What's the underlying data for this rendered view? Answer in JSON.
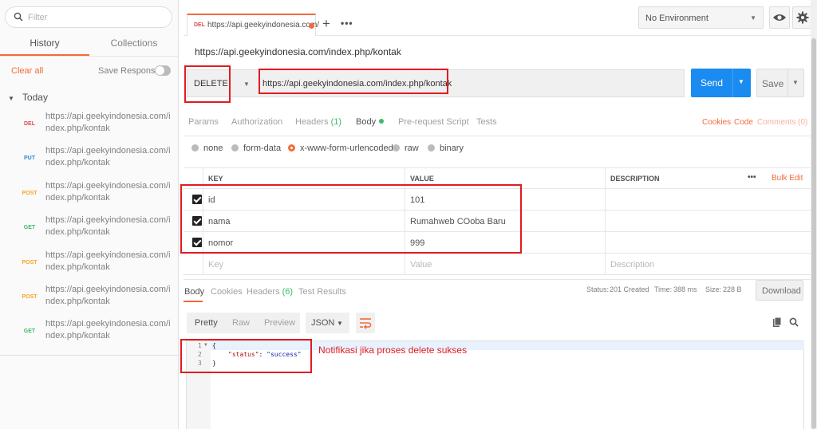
{
  "sidebar": {
    "filter_placeholder": "Filter",
    "tabs": [
      {
        "label": "History"
      },
      {
        "label": "Collections"
      }
    ],
    "clear_all": "Clear all",
    "save_responses": "Save Responses",
    "group_label": "Today",
    "items": [
      {
        "method": "DEL",
        "url": "https://api.geekyindonesia.com/index.php/kontak"
      },
      {
        "method": "PUT",
        "url": "https://api.geekyindonesia.com/index.php/kontak"
      },
      {
        "method": "POST",
        "url": "https://api.geekyindonesia.com/index.php/kontak"
      },
      {
        "method": "GET",
        "url": "https://api.geekyindonesia.com/index.php/kontak"
      },
      {
        "method": "POST",
        "url": "https://api.geekyindonesia.com/index.php/kontak"
      },
      {
        "method": "POST",
        "url": "https://api.geekyindonesia.com/index.php/kontak"
      },
      {
        "method": "GET",
        "url": "https://api.geekyindonesia.com/index.php/kontak"
      }
    ]
  },
  "tab": {
    "method": "DEL",
    "title": "https://api.geekyindonesia.com/"
  },
  "environment": "No Environment",
  "request": {
    "title": "https://api.geekyindonesia.com/index.php/kontak",
    "method": "DELETE",
    "url": "https://api.geekyindonesia.com/index.php/kontak",
    "send": "Send",
    "save": "Save"
  },
  "req_tabs": {
    "params": "Params",
    "authorization": "Authorization",
    "headers": "Headers",
    "headers_count": "(1)",
    "body": "Body",
    "prerequest": "Pre-request Script",
    "tests": "Tests",
    "cookies": "Cookies",
    "code": "Code",
    "comments": "Comments (0)"
  },
  "body_types": {
    "none": "none",
    "form_data": "form-data",
    "urlencoded": "x-www-form-urlencoded",
    "raw": "raw",
    "binary": "binary",
    "selected": "x-www-form-urlencoded"
  },
  "params_table": {
    "headers": {
      "key": "KEY",
      "value": "VALUE",
      "description": "DESCRIPTION",
      "more": "•••",
      "bulk_edit": "Bulk Edit"
    },
    "rows": [
      {
        "key": "id",
        "value": "101"
      },
      {
        "key": "nama",
        "value": "Rumahweb COoba Baru"
      },
      {
        "key": "nomor",
        "value": "999"
      }
    ],
    "placeholder": {
      "key": "Key",
      "value": "Value",
      "description": "Description"
    }
  },
  "response": {
    "tabs": {
      "body": "Body",
      "cookies": "Cookies",
      "headers": "Headers",
      "headers_count": "(6)",
      "test_results": "Test Results"
    },
    "status_label": "Status:",
    "status_value": "201 Created",
    "time_label": "Time:",
    "time_value": "388 ms",
    "size_label": "Size:",
    "size_value": "228 B",
    "download": "Download",
    "view_modes": {
      "pretty": "Pretty",
      "raw": "Raw",
      "preview": "Preview"
    },
    "format": "JSON",
    "code": {
      "line1_num": "1",
      "line2_num": "2",
      "line3_num": "3",
      "open": "{",
      "key": "\"status\"",
      "colon": ": ",
      "value": "\"success\"",
      "close": "}"
    }
  },
  "annotation": "Notifikasi jika proses delete sukses",
  "colors": {
    "accent": "#f26b3a",
    "send": "#1a8bf0",
    "annotation_red": "#e11b22",
    "status_green": "#3dba67"
  }
}
